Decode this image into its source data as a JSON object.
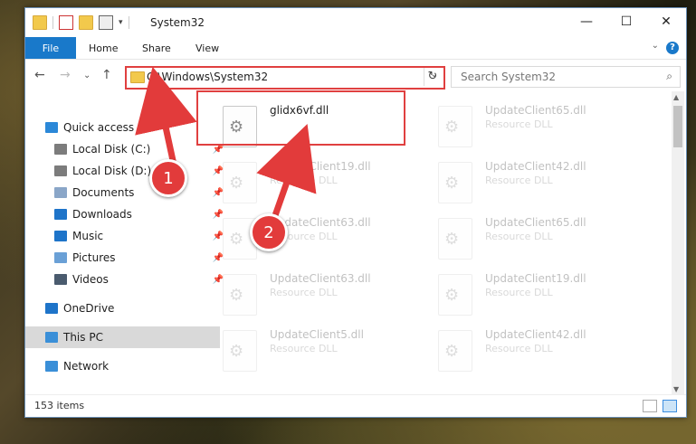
{
  "window": {
    "title": "System32",
    "controls": {
      "minimize": "—",
      "maximize": "☐",
      "close": "✕"
    }
  },
  "ribbon": {
    "file_tab": "File",
    "tabs": [
      "Home",
      "Share",
      "View"
    ],
    "help_icon": "?"
  },
  "nav": {
    "back": "←",
    "forward": "→",
    "recent": "⌄",
    "up": "↑",
    "address": "C:\\Windows\\System32",
    "search_placeholder": "Search System32",
    "refresh": "↻",
    "search_icon": "⌕"
  },
  "sidebar": {
    "items": [
      {
        "label": "Quick access",
        "icon": "star-icon",
        "color": "#2b88d8",
        "pinned": false
      },
      {
        "label": "Local Disk (C:)",
        "icon": "drive-icon",
        "color": "#7c7c7c",
        "pinned": true
      },
      {
        "label": "Local Disk (D:)",
        "icon": "drive-icon",
        "color": "#7c7c7c",
        "pinned": true
      },
      {
        "label": "Documents",
        "icon": "document-icon",
        "color": "#8aa6c8",
        "pinned": true
      },
      {
        "label": "Downloads",
        "icon": "download-icon",
        "color": "#1e74c9",
        "pinned": true
      },
      {
        "label": "Music",
        "icon": "music-icon",
        "color": "#1e74c9",
        "pinned": true
      },
      {
        "label": "Pictures",
        "icon": "pictures-icon",
        "color": "#6aa0d6",
        "pinned": true
      },
      {
        "label": "Videos",
        "icon": "video-icon",
        "color": "#4a5b6e",
        "pinned": true
      },
      {
        "label": "OneDrive",
        "icon": "cloud-icon",
        "color": "#1e74c9",
        "pinned": false
      },
      {
        "label": "This PC",
        "icon": "computer-icon",
        "color": "#3a8fd8",
        "pinned": false
      },
      {
        "label": "Network",
        "icon": "network-icon",
        "color": "#3a8fd8",
        "pinned": false
      }
    ]
  },
  "files": [
    {
      "name": "glidx6vf.dll",
      "type": "",
      "faded": false
    },
    {
      "name": "UpdateClient65.dll",
      "type": "Resource DLL",
      "faded": true
    },
    {
      "name": "UpdateClient19.dll",
      "type": "Resource DLL",
      "faded": true
    },
    {
      "name": "UpdateClient42.dll",
      "type": "Resource DLL",
      "faded": true
    },
    {
      "name": "UpdateClient63.dll",
      "type": "Resource DLL",
      "faded": true
    },
    {
      "name": "UpdateClient65.dll",
      "type": "Resource DLL",
      "faded": true
    },
    {
      "name": "UpdateClient63.dll",
      "type": "Resource DLL",
      "faded": true
    },
    {
      "name": "UpdateClient19.dll",
      "type": "Resource DLL",
      "faded": true
    },
    {
      "name": "UpdateClient5.dll",
      "type": "Resource DLL",
      "faded": true
    },
    {
      "name": "UpdateClient42.dll",
      "type": "Resource DLL",
      "faded": true
    }
  ],
  "status": {
    "item_count": "153 items"
  },
  "annotations": {
    "step1": "1",
    "step2": "2",
    "color": "#e23b3b"
  }
}
